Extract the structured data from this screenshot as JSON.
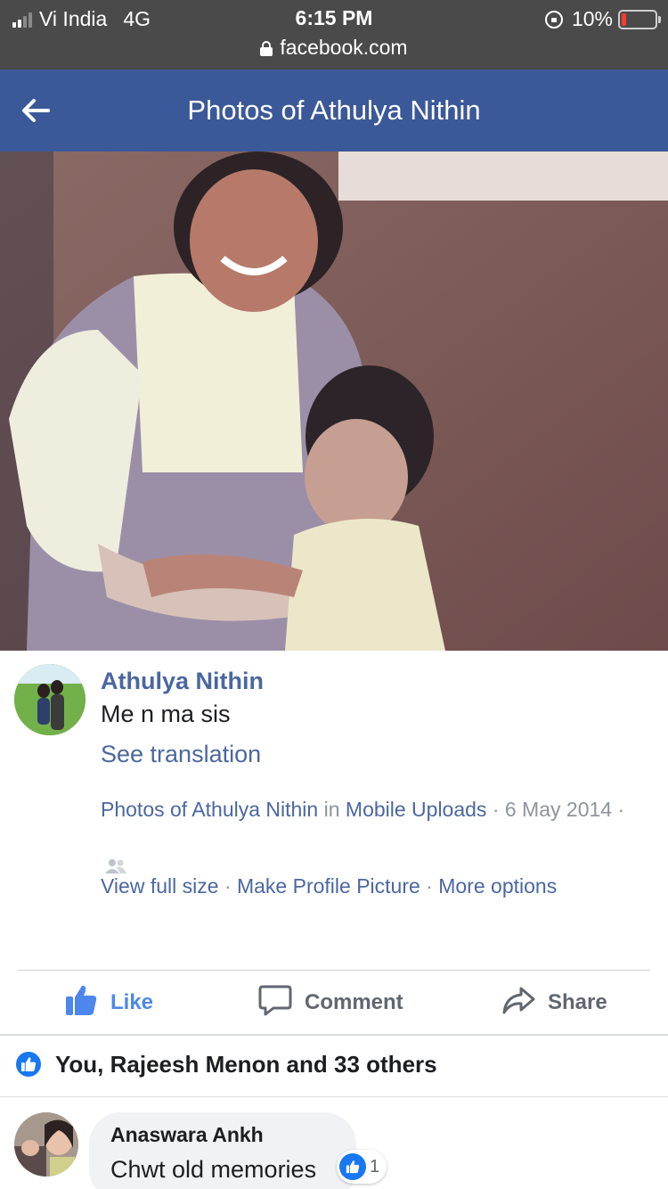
{
  "status_bar": {
    "carrier": "Vi India",
    "network": "4G",
    "time": "6:15 PM",
    "battery": "10%",
    "url": "facebook.com"
  },
  "header": {
    "title": "Photos of Athulya Nithin"
  },
  "post": {
    "author": "Athulya Nithin",
    "caption": "Me n ma sis",
    "see_translation": "See translation",
    "album_link": "Photos of Athulya Nithin",
    "in_word": " in ",
    "album_name": "Mobile Uploads",
    "date_text": " · 6 May 2014 · ",
    "audience_icon": "friends-icon",
    "view_full_size": "View full size",
    "make_profile_picture": "Make Profile Picture",
    "more_options": "More options",
    "link_separator": " · "
  },
  "actions": {
    "like": "Like",
    "comment": "Comment",
    "share": "Share"
  },
  "reactions": {
    "summary": "You, Rajeesh Menon and 33 others"
  },
  "comments": [
    {
      "author": "Anaswara Ankh",
      "text": "Chwt old memories",
      "like_count": "1"
    }
  ],
  "colors": {
    "status_bar": "#4a4a4a",
    "header": "#3b5998",
    "link": "#4b67a1",
    "like_active": "#4d87ec",
    "reaction_blue": "#1877f2"
  }
}
